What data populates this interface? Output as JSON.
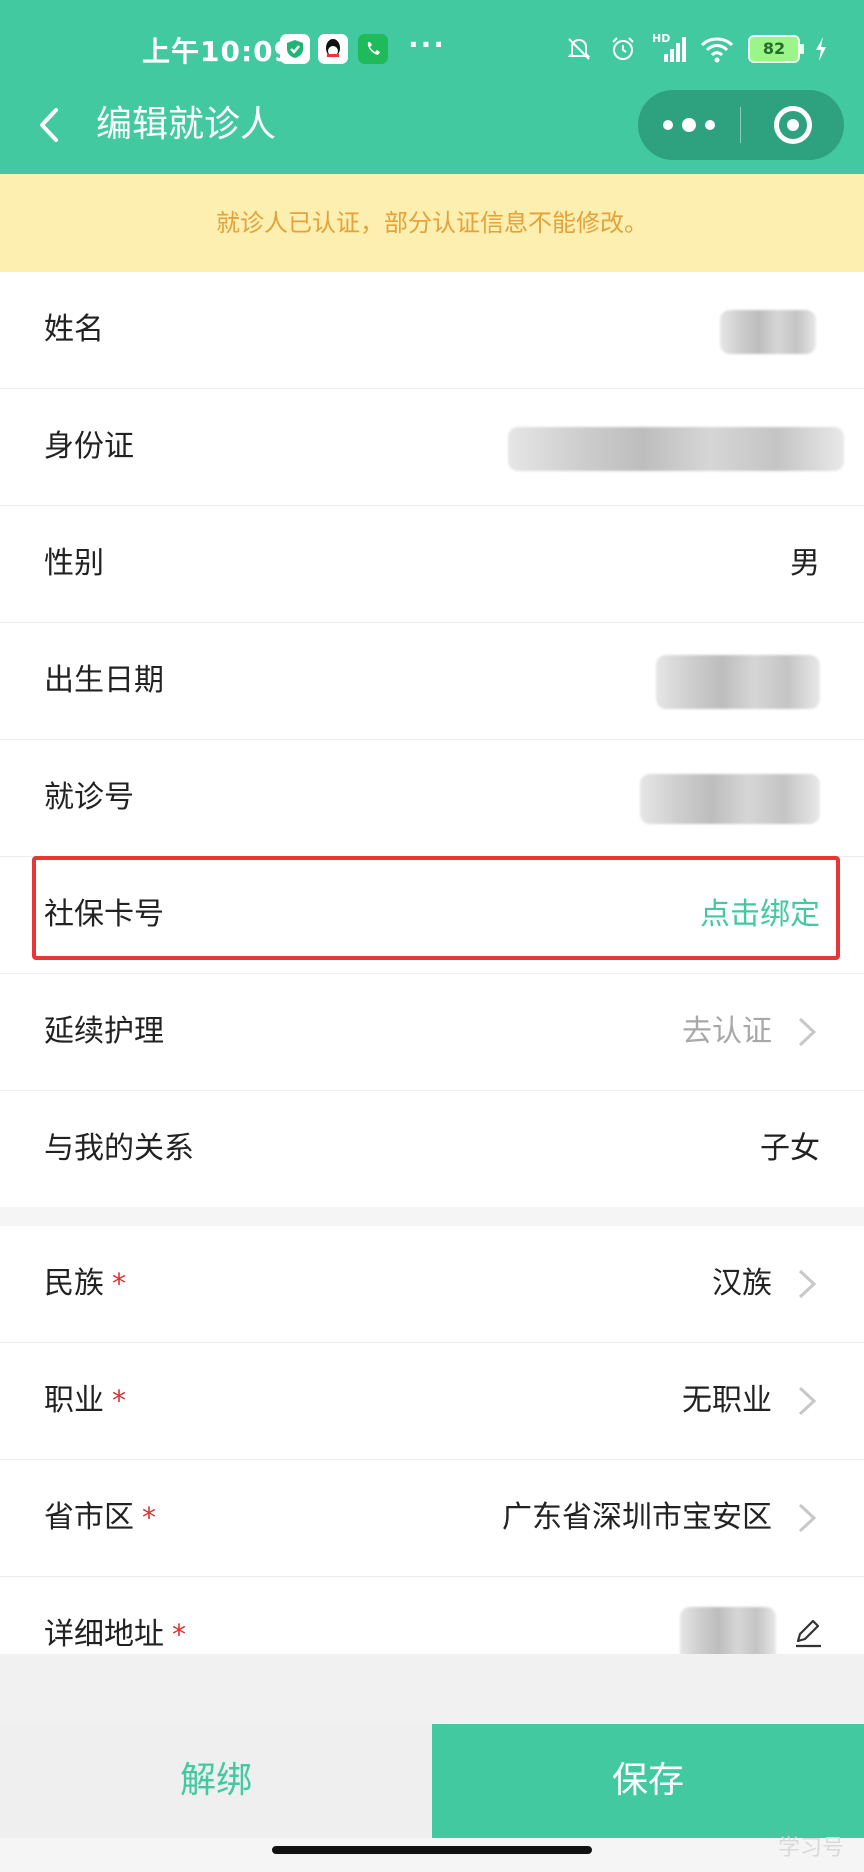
{
  "status_bar": {
    "time": "上午10:09",
    "more_dots": "···",
    "battery": "82",
    "signal_label": "HD"
  },
  "nav": {
    "title": "编辑就诊人"
  },
  "notice": "就诊人已认证，部分认证信息不能修改。",
  "fields_group1": [
    {
      "label": "姓名",
      "value": ""
    },
    {
      "label": "身份证",
      "value": ""
    },
    {
      "label": "性别",
      "value": "男"
    },
    {
      "label": "出生日期",
      "value": ""
    },
    {
      "label": "就诊号",
      "value": ""
    },
    {
      "label": "社保卡号",
      "value": "点击绑定"
    },
    {
      "label": "延续护理",
      "value": "去认证"
    },
    {
      "label": "与我的关系",
      "value": "子女"
    }
  ],
  "fields_group2": [
    {
      "label": "民族",
      "required": "*",
      "value": "汉族"
    },
    {
      "label": "职业",
      "required": "*",
      "value": "无职业"
    },
    {
      "label": "省市区",
      "required": "*",
      "value": "广东省深圳市宝安区"
    },
    {
      "label": "详细地址",
      "required": "*",
      "value": ""
    }
  ],
  "buttons": {
    "unbind": "解绑",
    "save": "保存"
  },
  "watermark": "学习号",
  "colors": {
    "primary": "#43c9a0",
    "notice_bg": "#fdefb0",
    "notice_text": "#e3a23a",
    "required": "#d93030",
    "highlight": "#e63636"
  }
}
